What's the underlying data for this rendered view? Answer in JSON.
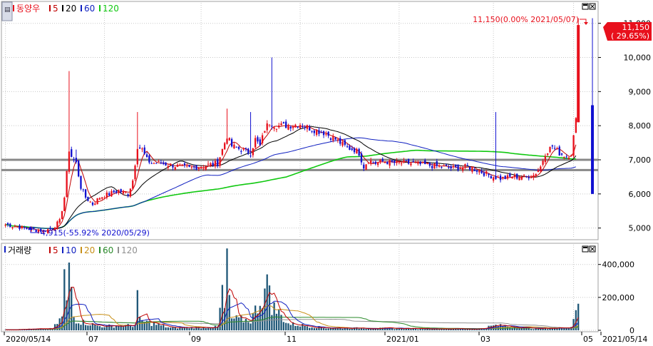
{
  "colors": {
    "up": "#e8101c",
    "down": "#1010d0",
    "ma5": "#c00000",
    "ma20": "#000000",
    "ma60": "#1020c0",
    "ma120": "#10c810",
    "vma5": "#c00000",
    "vma10": "#1020c0",
    "vma20": "#c89018",
    "vma60": "#2a8a2a",
    "vma120": "#909090",
    "volume": "#205878",
    "priceBadge": "#e8101c",
    "hline": "#888888"
  },
  "price_panel": {
    "title": "동양우",
    "legend": [
      {
        "label": "5",
        "color_key": "ma5"
      },
      {
        "label": "20",
        "color_key": "ma20"
      },
      {
        "label": "60",
        "color_key": "ma60"
      },
      {
        "label": "120",
        "color_key": "ma120"
      }
    ],
    "current_price": "11,150",
    "current_change": "( 29.65%)",
    "high_annotation": "11,150(0.00% 2021/05/07)",
    "low_annotation": "4,915(-55.92% 2020/05/29)",
    "y_ticks": [
      "11,000",
      "10,000",
      "9,000",
      "8,000",
      "7,000",
      "6,000",
      "5,000"
    ]
  },
  "volume_panel": {
    "title": "거래량",
    "legend": [
      {
        "label": "5",
        "color_key": "vma5"
      },
      {
        "label": "10",
        "color_key": "vma10"
      },
      {
        "label": "20",
        "color_key": "vma20"
      },
      {
        "label": "60",
        "color_key": "vma60"
      },
      {
        "label": "120",
        "color_key": "vma120"
      }
    ],
    "y_ticks": [
      "400,000",
      "200,000",
      "0"
    ]
  },
  "x_axis": {
    "labels": [
      "2020/05/14",
      "07",
      "09",
      "11",
      "2021/01",
      "03",
      "05",
      "2021/05/14"
    ]
  },
  "chart_data": {
    "type": "candlestick",
    "price_ylim": [
      4700,
      11600
    ],
    "volume_ylim": [
      0,
      520000
    ],
    "horizontal_lines": [
      7000,
      6700
    ],
    "days": 250,
    "anchor_closes": [
      [
        0,
        5100
      ],
      [
        8,
        5000
      ],
      [
        12,
        4950
      ],
      [
        16,
        4915
      ],
      [
        20,
        5000
      ],
      [
        23,
        5200
      ],
      [
        25,
        5900
      ],
      [
        27,
        7300
      ],
      [
        28,
        7100
      ],
      [
        30,
        6900
      ],
      [
        32,
        6200
      ],
      [
        34,
        5900
      ],
      [
        37,
        5700
      ],
      [
        40,
        5900
      ],
      [
        44,
        6000
      ],
      [
        48,
        6100
      ],
      [
        52,
        6000
      ],
      [
        54,
        6400
      ],
      [
        56,
        7400
      ],
      [
        58,
        7300
      ],
      [
        60,
        7000
      ],
      [
        62,
        6900
      ],
      [
        66,
        6900
      ],
      [
        70,
        6850
      ],
      [
        74,
        6800
      ],
      [
        78,
        6750
      ],
      [
        82,
        6800
      ],
      [
        86,
        6850
      ],
      [
        90,
        6900
      ],
      [
        92,
        7300
      ],
      [
        94,
        7700
      ],
      [
        96,
        7400
      ],
      [
        100,
        7300
      ],
      [
        104,
        7200
      ],
      [
        106,
        7600
      ],
      [
        108,
        7400
      ],
      [
        110,
        7900
      ],
      [
        112,
        8100
      ],
      [
        115,
        8000
      ],
      [
        120,
        8000
      ],
      [
        125,
        8050
      ],
      [
        130,
        7900
      ],
      [
        135,
        7800
      ],
      [
        140,
        7600
      ],
      [
        145,
        7350
      ],
      [
        148,
        7300
      ],
      [
        150,
        7200
      ],
      [
        152,
        6800
      ],
      [
        154,
        7000
      ],
      [
        157,
        6900
      ],
      [
        160,
        6950
      ],
      [
        166,
        6900
      ],
      [
        172,
        6900
      ],
      [
        178,
        6850
      ],
      [
        184,
        6800
      ],
      [
        190,
        6750
      ],
      [
        196,
        6800
      ],
      [
        200,
        6700
      ],
      [
        205,
        6550
      ],
      [
        210,
        6450
      ],
      [
        215,
        6500
      ],
      [
        220,
        6500
      ],
      [
        224,
        6550
      ],
      [
        227,
        6800
      ],
      [
        229,
        7200
      ],
      [
        232,
        7400
      ],
      [
        235,
        7200
      ],
      [
        238,
        7100
      ],
      [
        240,
        7200
      ],
      [
        242,
        8150
      ],
      [
        243,
        10950
      ],
      [
        249,
        8600
      ]
    ],
    "spikes": [
      {
        "day": 27,
        "high": 9600
      },
      {
        "day": 30,
        "high": 7300
      },
      {
        "day": 56,
        "high": 8400
      },
      {
        "day": 94,
        "high": 8500
      },
      {
        "day": 104,
        "high": 8400
      },
      {
        "day": 113,
        "high": 10000
      },
      {
        "day": 208,
        "high": 8400
      },
      {
        "day": 243,
        "high": 11150
      }
    ],
    "big_candles": [
      {
        "day": 243,
        "open": 8100,
        "close": 10950,
        "high": 11150,
        "low": 8100,
        "dir": "up"
      },
      {
        "day": 249,
        "open": 8600,
        "close": 6000,
        "high": 11150,
        "low": 6000,
        "dir": "down"
      }
    ],
    "volume_anchors": [
      [
        0,
        4000
      ],
      [
        20,
        10000
      ],
      [
        24,
        80000
      ],
      [
        25,
        320000
      ],
      [
        26,
        150000
      ],
      [
        27,
        420000
      ],
      [
        28,
        260000
      ],
      [
        29,
        120000
      ],
      [
        30,
        60000
      ],
      [
        40,
        25000
      ],
      [
        55,
        30000
      ],
      [
        56,
        200000
      ],
      [
        57,
        60000
      ],
      [
        70,
        15000
      ],
      [
        90,
        20000
      ],
      [
        92,
        230000
      ],
      [
        93,
        120000
      ],
      [
        94,
        470000
      ],
      [
        95,
        160000
      ],
      [
        96,
        70000
      ],
      [
        104,
        60000
      ],
      [
        106,
        120000
      ],
      [
        112,
        290000
      ],
      [
        113,
        150000
      ],
      [
        120,
        40000
      ],
      [
        135,
        15000
      ],
      [
        160,
        12000
      ],
      [
        200,
        8000
      ],
      [
        208,
        30000
      ],
      [
        225,
        10000
      ],
      [
        235,
        15000
      ],
      [
        240,
        20000
      ],
      [
        242,
        150000
      ],
      [
        243,
        200000
      ],
      [
        249,
        0
      ]
    ]
  }
}
